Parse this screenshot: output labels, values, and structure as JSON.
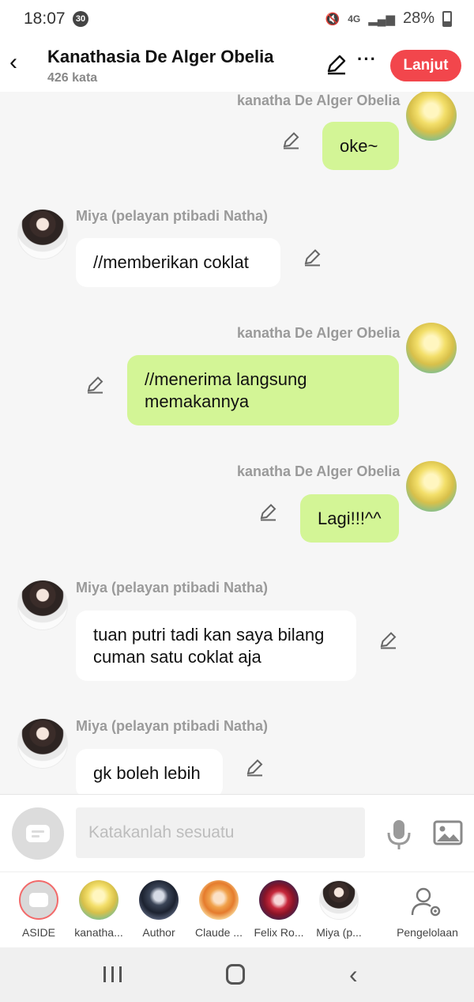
{
  "status": {
    "time": "18:07",
    "notification_count": "30",
    "network": "4G",
    "battery": "28%"
  },
  "header": {
    "back_icon": "back-arrow-icon",
    "title": "Kanathasia De Alger Obelia",
    "subtitle": "426 kata",
    "more": "···",
    "next_label": "Lanjut"
  },
  "messages": [
    {
      "side": "me",
      "name": "kanatha De Alger Obelia",
      "text": "oke~"
    },
    {
      "side": "them",
      "name": "Miya (pelayan ptibadi Natha)",
      "text": "//memberikan coklat"
    },
    {
      "side": "me",
      "name": "kanatha De Alger Obelia",
      "text": "//menerima langsung memakannya"
    },
    {
      "side": "me",
      "name": "kanatha De Alger Obelia",
      "text": "Lagi!!!^^"
    },
    {
      "side": "them",
      "name": "Miya (pelayan ptibadi Natha)",
      "text": "tuan putri tadi kan saya bilang cuman satu coklat aja"
    },
    {
      "side": "them",
      "name": "Miya (pelayan ptibadi Natha)",
      "text": "gk boleh lebih"
    }
  ],
  "input": {
    "placeholder": "Katakanlah sesuatu"
  },
  "characters": [
    {
      "label": "ASIDE",
      "avatar": "aside"
    },
    {
      "label": "kanatha...",
      "avatar": "blonde"
    },
    {
      "label": "Author",
      "avatar": "author"
    },
    {
      "label": "Claude ...",
      "avatar": "claude"
    },
    {
      "label": "Felix Ro...",
      "avatar": "felix"
    },
    {
      "label": "Miya (p...",
      "avatar": "maid"
    }
  ],
  "manage_label": "Pengelolaan",
  "colors": {
    "accent": "#f2464c",
    "my_bubble": "#d3f596",
    "their_bubble": "#ffffff",
    "name_text": "#9a9a9a"
  }
}
